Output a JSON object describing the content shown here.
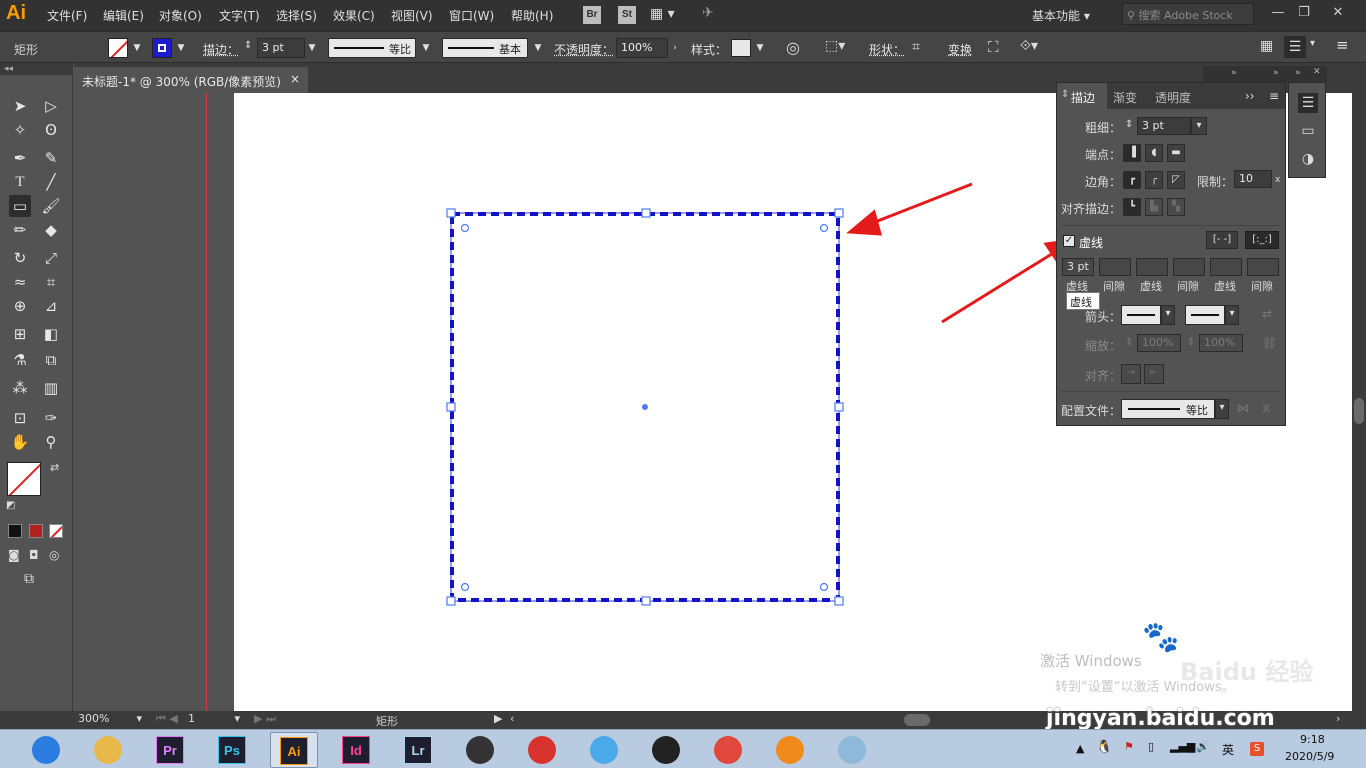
{
  "app": {
    "logo": "Ai",
    "title": "Adobe Illustrator"
  },
  "menu": {
    "items": [
      "文件(F)",
      "编辑(E)",
      "对象(O)",
      "文字(T)",
      "选择(S)",
      "效果(C)",
      "视图(V)",
      "窗口(W)",
      "帮助(H)"
    ],
    "br": "Br",
    "st": "St",
    "workspace": "基本功能",
    "search_placeholder": "搜索 Adobe Stock"
  },
  "control": {
    "selection": "矩形",
    "stroke_label": "描边：",
    "stroke_value": "3 pt",
    "profile_label": "等比",
    "brush_label": "基本",
    "opacity_label": "不透明度：",
    "opacity_value": "100%",
    "style_label": "样式：",
    "shape_label": "形状：",
    "transform_label": "变换"
  },
  "document": {
    "tab_title": "未标题-1* @ 300% (RGB/像素预览)",
    "close": "×"
  },
  "stroke_panel": {
    "tabs": [
      "描边",
      "渐变",
      "透明度"
    ],
    "weight_label": "粗细：",
    "weight_value": "3 pt",
    "cap_label": "端点：",
    "corner_label": "边角：",
    "limit_label": "限制：",
    "limit_value": "10",
    "limit_unit": "x",
    "align_label": "对齐描边：",
    "dashed_label": "虚线",
    "dashed_checked": true,
    "dash_values": [
      "3 pt",
      "",
      "",
      "",
      "",
      ""
    ],
    "dash_labels": [
      "虚线",
      "间隙",
      "虚线",
      "间隙",
      "虚线",
      "间隙"
    ],
    "tooltip": "虚线",
    "arrow_label": "箭头：",
    "scale_label": "缩放：",
    "scale_values": [
      "100%",
      "100%"
    ],
    "align_arrow_label": "对齐：",
    "profile_label": "配置文件：",
    "profile_value": "等比"
  },
  "status": {
    "zoom": "300%",
    "page": "1",
    "tool": "矩形"
  },
  "taskbar": {
    "apps": [
      {
        "name": "browser-360",
        "label": "",
        "color": "#2b7de1"
      },
      {
        "name": "file-explorer",
        "label": "",
        "color": "#e8b84a"
      },
      {
        "name": "premiere",
        "label": "Pr",
        "color": "#e77bff"
      },
      {
        "name": "photoshop",
        "label": "Ps",
        "color": "#31c5f0"
      },
      {
        "name": "illustrator",
        "label": "Ai",
        "color": "#ff9a00"
      },
      {
        "name": "indesign",
        "label": "Id",
        "color": "#ff3f94"
      },
      {
        "name": "lightroom",
        "label": "Lr",
        "color": "#add5ec"
      },
      {
        "name": "video-player",
        "label": "",
        "color": "#333333"
      },
      {
        "name": "umbrella-app",
        "label": "",
        "color": "#d9332f"
      },
      {
        "name": "bird-app",
        "label": "",
        "color": "#4aa9e8"
      },
      {
        "name": "qq",
        "label": "",
        "color": "#222222"
      },
      {
        "name": "chrome",
        "label": "",
        "color": "#e0473d"
      },
      {
        "name": "fox-app",
        "label": "",
        "color": "#f08a1d"
      },
      {
        "name": "notebook-app",
        "label": "",
        "color": "#8fb9d9"
      }
    ],
    "ime": "英",
    "time": "9:18",
    "date": "2020/5/9"
  },
  "watermark": {
    "activate": "激活 Windows",
    "activate_sub": "转到“设置”以激活 Windows。",
    "site": "jingyan.baidu.com",
    "brand": "Baidu 经验"
  },
  "colors": {
    "selection_blue": "#0000cc",
    "anchor_blue": "#4c7cf0",
    "arrow_red": "#e31b1b"
  }
}
